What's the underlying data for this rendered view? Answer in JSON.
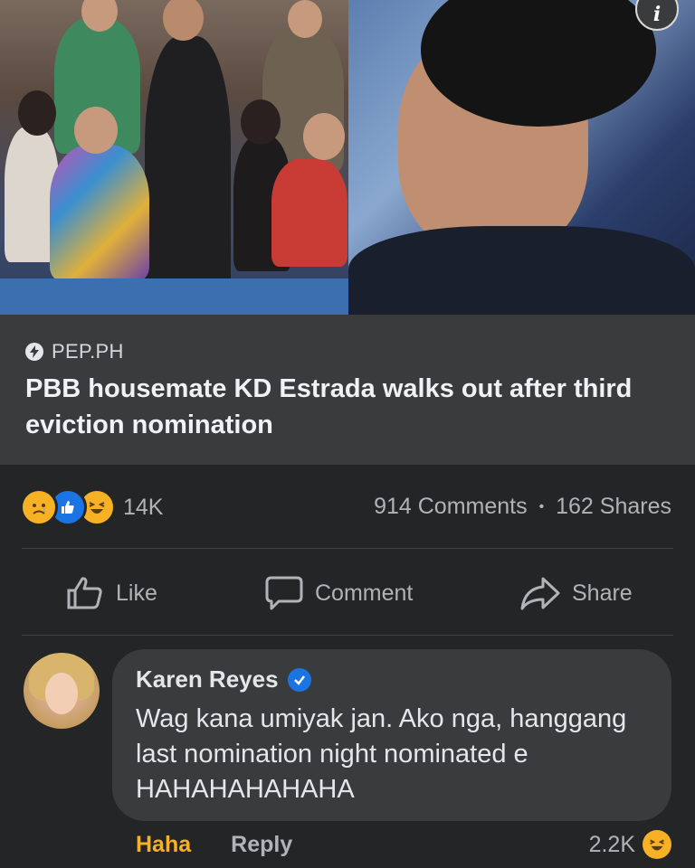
{
  "post": {
    "image": {
      "left_alt": "housemates seated on sofa",
      "right_alt": "crying housemate",
      "info_icon": "info-icon"
    },
    "link": {
      "source": "PEP.PH",
      "source_icon": "lightning-bolt-icon",
      "headline": "PBB housemate KD Estrada walks out after third eviction nomination"
    },
    "stats": {
      "reactions": [
        "sad-icon",
        "like-icon",
        "haha-icon"
      ],
      "reaction_count": "14K",
      "comments": "914 Comments",
      "separator": "•",
      "shares": "162 Shares"
    },
    "actions": {
      "like": "Like",
      "comment": "Comment",
      "share": "Share"
    }
  },
  "comment": {
    "author": "Karen Reyes",
    "verified": true,
    "text": "Wag kana umiyak jan. Ako nga, hanggang last nomination night nominated e HAHAHAHAHAHA",
    "reaction_label": "Haha",
    "reply_label": "Reply",
    "reaction_count": "2.2K",
    "reaction_icon": "haha-icon"
  },
  "colors": {
    "background": "#242526",
    "card": "#3a3b3c",
    "accent_blue": "#1b74e4",
    "haha_yellow": "#f7b125",
    "secondary_text": "#b0b3b8"
  }
}
